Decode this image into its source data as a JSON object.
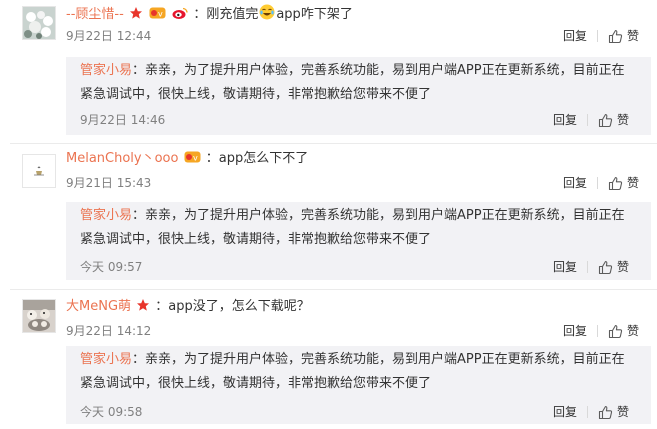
{
  "comments": [
    {
      "username": "--顾尘惜--",
      "text": "：刚充值完",
      "text_after": "app咋下架了",
      "time": "9月22日 12:44",
      "reply_label": "回复",
      "like_label": "赞",
      "reply": {
        "name": "管家小易",
        "text": "：亲亲，为了提升用户体验，完善系统功能，易到用户端APP正在更新系统，目前正在紧急调试中，很快上线，敬请期待，非常抱歉给您带来不便了",
        "time": "9月22日 14:46",
        "reply_label": "回复",
        "like_label": "赞"
      }
    },
    {
      "username": "MelanCholy丶ooo",
      "text": "：app怎么下不了",
      "time": "9月21日 15:43",
      "reply_label": "回复",
      "like_label": "赞",
      "reply": {
        "name": "管家小易",
        "text": "：亲亲，为了提升用户体验，完善系统功能，易到用户端APP正在更新系统，目前正在紧急调试中，很快上线，敬请期待，非常抱歉给您带来不便了",
        "time": "今天 09:57",
        "reply_label": "回复",
        "like_label": "赞"
      }
    },
    {
      "username": "大MeNG萌",
      "text": "：app没了，怎么下载呢？",
      "time": "9月22日 14:12",
      "reply_label": "回复",
      "like_label": "赞",
      "reply": {
        "name": "管家小易",
        "text": "：亲亲，为了提升用户体验，完善系统功能，易到用户端APP正在更新系统，目前正在紧急调试中，很快上线，敬请期待，非常抱歉给您带来不便了",
        "time": "今天 09:58",
        "reply_label": "回复",
        "like_label": "赞"
      }
    }
  ],
  "colors": {
    "name": "#eb7350",
    "time": "#808080",
    "reply_bg": "#f2f2f5"
  }
}
